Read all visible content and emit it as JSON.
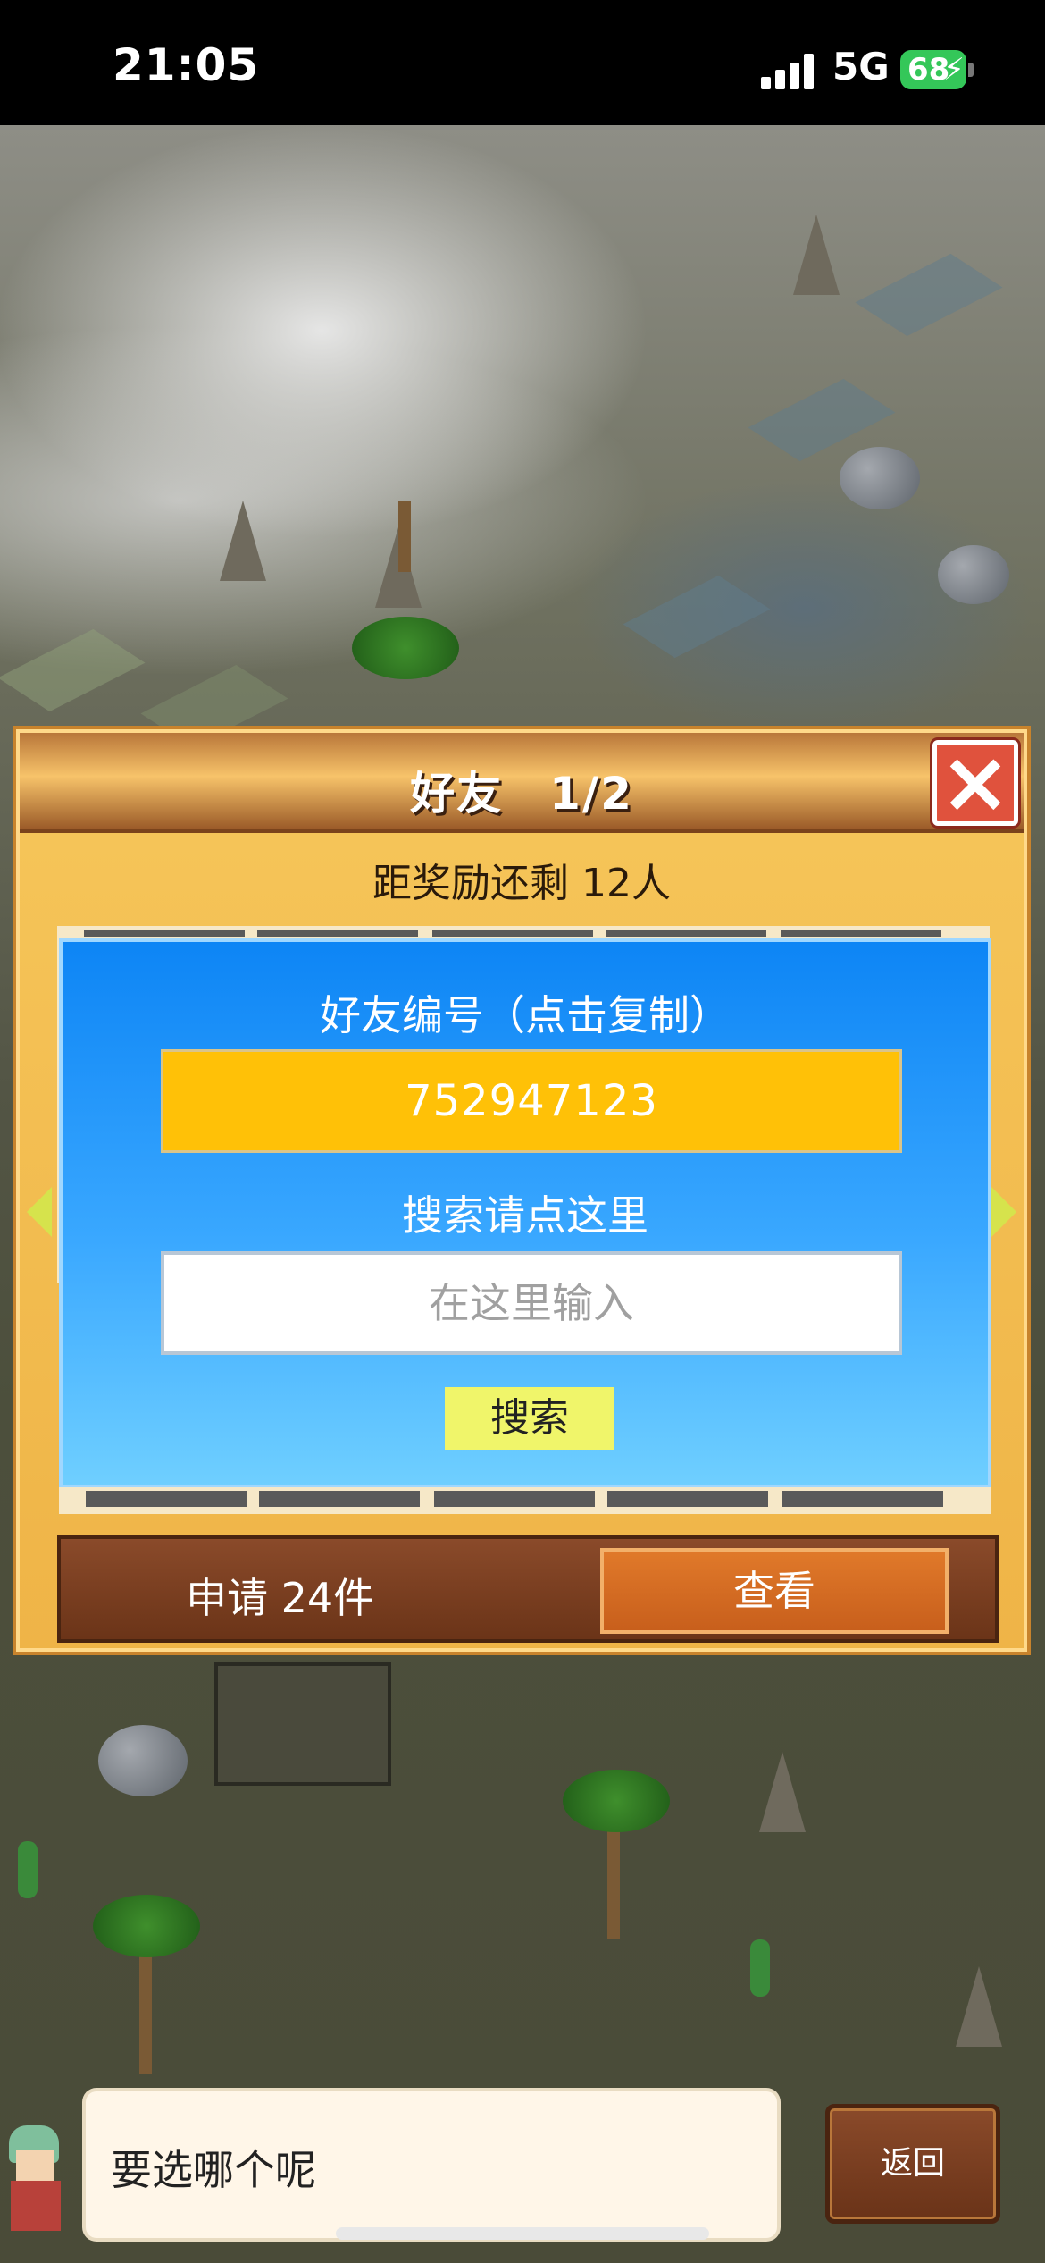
{
  "status_bar": {
    "time": "21:05",
    "network": "5G",
    "battery": "68"
  },
  "dialog": {
    "title": "好友　1/2",
    "reward_text": "距奖励还剩 12人",
    "friend_id_label": "好友编号（点击复制）",
    "friend_id": "752947123",
    "search_label": "搜索请点这里",
    "search_placeholder": "在这里输入",
    "search_button": "搜索",
    "apply_text": "申请 24件",
    "view_button": "查看"
  },
  "bottom": {
    "speech_text": "要选哪个呢",
    "back_button": "返回"
  },
  "colors": {
    "dialog_bg": "#efb447",
    "blue_panel": "#3aa8ff",
    "friend_id_box": "#ffc107",
    "search_button": "#f0f56a",
    "close_button": "#e0523d",
    "view_button": "#d96d23"
  }
}
